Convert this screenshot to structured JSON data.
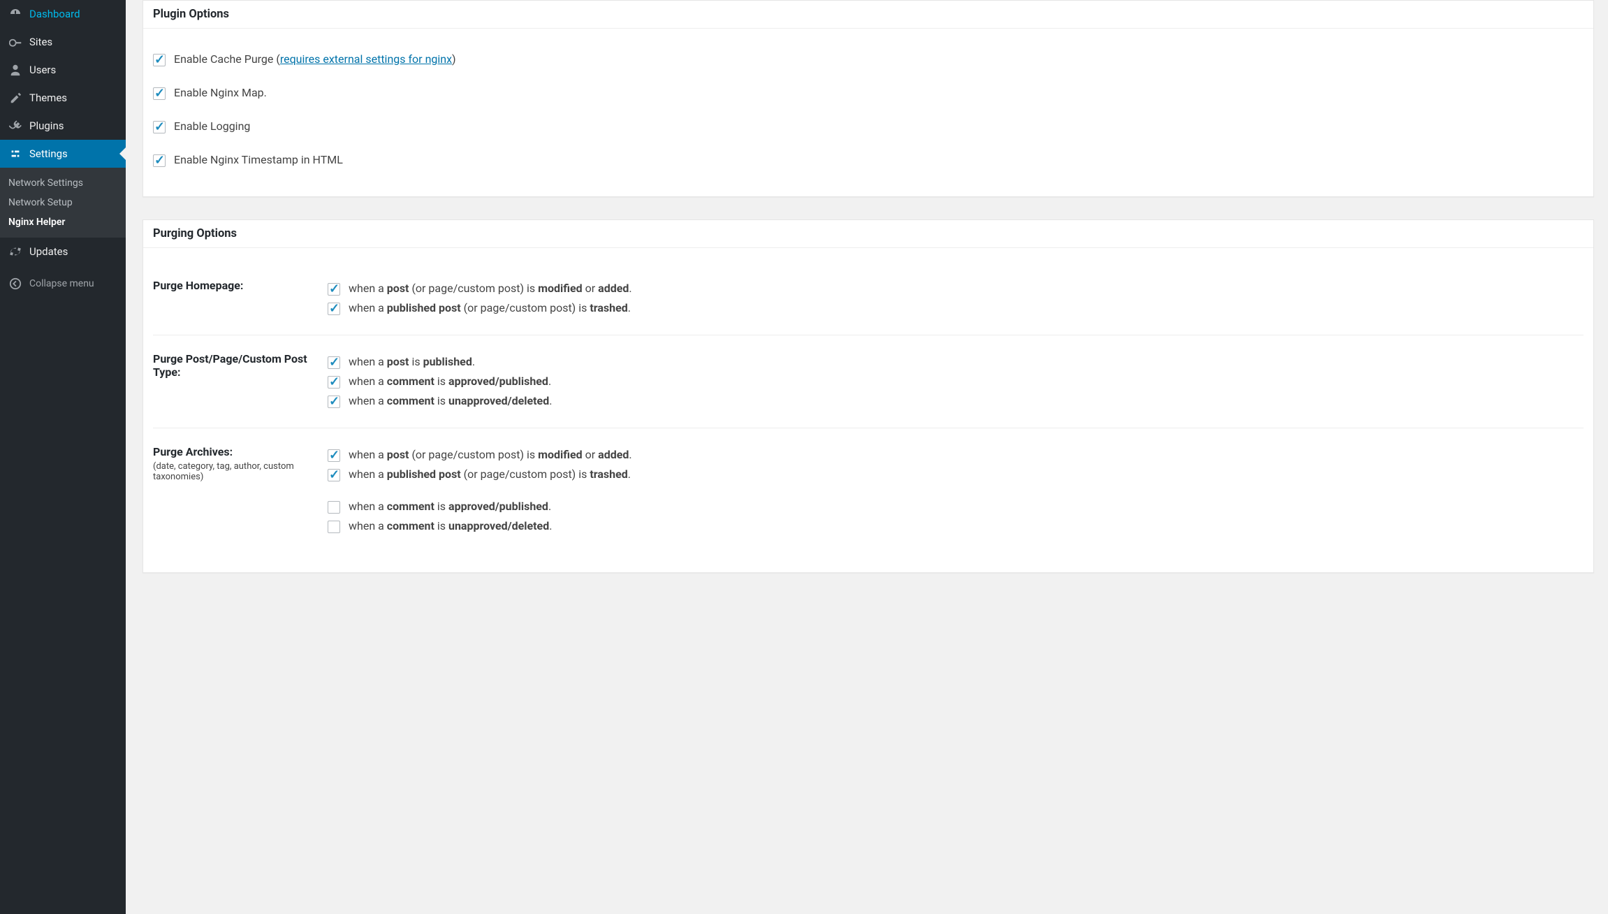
{
  "sidebar": {
    "items": [
      {
        "label": "Dashboard",
        "icon": "dashboard"
      },
      {
        "label": "Sites",
        "icon": "sites"
      },
      {
        "label": "Users",
        "icon": "users"
      },
      {
        "label": "Themes",
        "icon": "themes"
      },
      {
        "label": "Plugins",
        "icon": "plugins"
      },
      {
        "label": "Settings",
        "icon": "settings"
      },
      {
        "label": "Updates",
        "icon": "updates"
      }
    ],
    "submenu": [
      {
        "label": "Network Settings"
      },
      {
        "label": "Network Setup"
      },
      {
        "label": "Nginx Helper"
      }
    ],
    "collapse": "Collapse menu"
  },
  "panel1": {
    "title": "Plugin Options",
    "opt1_pre": "Enable Cache Purge (",
    "opt1_link": "requires external settings for nginx",
    "opt1_post": ")",
    "opt2": "Enable Nginx Map.",
    "opt3": "Enable Logging",
    "opt4": "Enable Nginx Timestamp in HTML"
  },
  "panel2": {
    "title": "Purging Options",
    "row1": {
      "label": "Purge Homepage:",
      "o1": {
        "p1": "when a ",
        "b1": "post",
        "p2": " (or page/custom post) is ",
        "b2": "modified",
        "p3": " or ",
        "b3": "added",
        "p4": "."
      },
      "o2": {
        "p1": "when a ",
        "b1": "published post",
        "p2": " (or page/custom post) is ",
        "b2": "trashed",
        "p3": "."
      }
    },
    "row2": {
      "label": "Purge Post/Page/Custom Post Type:",
      "o1": {
        "p1": "when a ",
        "b1": "post",
        "p2": " is ",
        "b2": "published",
        "p3": "."
      },
      "o2": {
        "p1": "when a ",
        "b1": "comment",
        "p2": " is ",
        "b2": "approved/published",
        "p3": "."
      },
      "o3": {
        "p1": "when a ",
        "b1": "comment",
        "p2": " is ",
        "b2": "unapproved/deleted",
        "p3": "."
      }
    },
    "row3": {
      "label": "Purge Archives:",
      "sub": "(date, category, tag, author, custom taxonomies)",
      "o1": {
        "p1": "when a ",
        "b1": "post",
        "p2": " (or page/custom post) is ",
        "b2": "modified",
        "p3": " or ",
        "b3": "added",
        "p4": "."
      },
      "o2": {
        "p1": "when a ",
        "b1": "published post",
        "p2": " (or page/custom post) is ",
        "b2": "trashed",
        "p3": "."
      },
      "o3": {
        "p1": "when a ",
        "b1": "comment",
        "p2": " is ",
        "b2": "approved/published",
        "p3": "."
      },
      "o4": {
        "p1": "when a ",
        "b1": "comment",
        "p2": " is ",
        "b2": "unapproved/deleted",
        "p3": "."
      }
    }
  }
}
